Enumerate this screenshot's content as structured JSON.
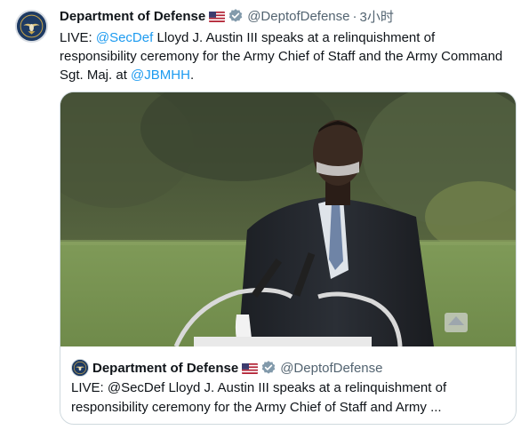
{
  "tweet": {
    "author_name": "Department of Defense",
    "author_handle": "@DeptofDefense",
    "separator": "·",
    "time": "3小时",
    "text_prefix": "LIVE: ",
    "mention_1": "@SecDef",
    "text_middle": " Lloyd J. Austin III speaks at a relinquishment of responsibility ceremony for the Army Chief of Staff and the Army Command Sgt. Maj. at ",
    "mention_2": "@JBMHH",
    "text_suffix": "."
  },
  "quote": {
    "author_name": "Department of Defense",
    "author_handle": "@DeptofDefense",
    "text": "LIVE: @SecDef Lloyd J. Austin III speaks at a relinquishment of responsibility ceremony for the Army Chief of Staff and Army ..."
  },
  "icons": {
    "avatar": "dod-seal-icon",
    "flag": "us-flag-icon",
    "verified": "verified-badge-icon"
  },
  "colors": {
    "link": "#1d9bf0",
    "secondary_text": "#536471",
    "border": "#cfd9de",
    "verified": "#829aab"
  }
}
